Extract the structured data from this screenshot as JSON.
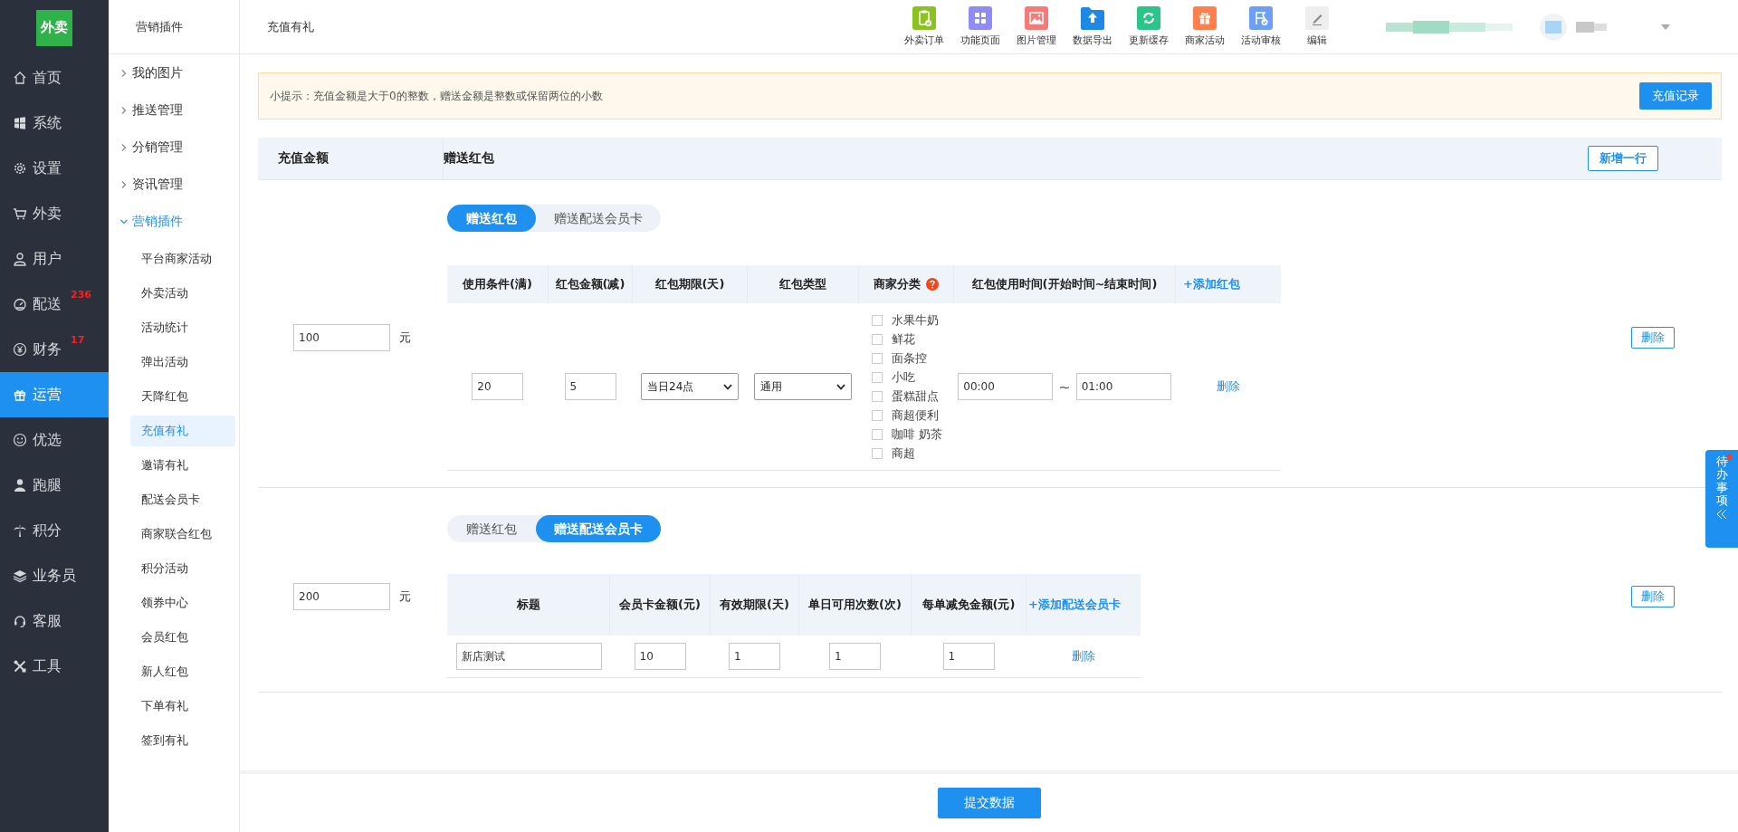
{
  "logo": {
    "text": "外卖"
  },
  "nav": [
    {
      "label": "首页",
      "selected": false
    },
    {
      "label": "系统",
      "selected": false
    },
    {
      "label": "设置",
      "selected": false
    },
    {
      "label": "外卖",
      "selected": false
    },
    {
      "label": "用户",
      "selected": false
    },
    {
      "label": "配送",
      "selected": false,
      "badge": "236"
    },
    {
      "label": "财务",
      "selected": false,
      "badge": "17"
    },
    {
      "label": "运营",
      "selected": true
    },
    {
      "label": "优选",
      "selected": false
    },
    {
      "label": "跑腿",
      "selected": false
    },
    {
      "label": "积分",
      "selected": false
    },
    {
      "label": "业务员",
      "selected": false
    },
    {
      "label": "客服",
      "selected": false
    },
    {
      "label": "工具",
      "selected": false
    }
  ],
  "submenu": {
    "title": "营销插件",
    "groups": [
      {
        "label": "我的图片",
        "expanded": false
      },
      {
        "label": "推送管理",
        "expanded": false
      },
      {
        "label": "分销管理",
        "expanded": false
      },
      {
        "label": "资讯管理",
        "expanded": false
      },
      {
        "label": "营销插件",
        "expanded": true,
        "children": [
          {
            "label": "平台商家活动",
            "selected": false
          },
          {
            "label": "外卖活动",
            "selected": false
          },
          {
            "label": "活动统计",
            "selected": false
          },
          {
            "label": "弹出活动",
            "selected": false
          },
          {
            "label": "天降红包",
            "selected": false
          },
          {
            "label": "充值有礼",
            "selected": true
          },
          {
            "label": "邀请有礼",
            "selected": false
          },
          {
            "label": "配送会员卡",
            "selected": false
          },
          {
            "label": "商家联合红包",
            "selected": false
          },
          {
            "label": "积分活动",
            "selected": false
          },
          {
            "label": "领券中心",
            "selected": false
          },
          {
            "label": "会员红包",
            "selected": false
          },
          {
            "label": "新人红包",
            "selected": false
          },
          {
            "label": "下单有礼",
            "selected": false
          },
          {
            "label": "签到有礼",
            "selected": false
          }
        ]
      }
    ]
  },
  "header": {
    "title": "充值有礼",
    "tools": [
      {
        "label": "外卖订单",
        "color": "#8cc220"
      },
      {
        "label": "功能页面",
        "color": "#8f8cf5"
      },
      {
        "label": "图片管理",
        "color": "#f77a76"
      },
      {
        "label": "数据导出",
        "color": "#1e88e5"
      },
      {
        "label": "更新缓存",
        "color": "#2bc489"
      },
      {
        "label": "商家活动",
        "color": "#ff7f4d"
      },
      {
        "label": "活动审核",
        "color": "#6d9ff5"
      },
      {
        "label": "编辑",
        "color": "#eeeeee"
      }
    ]
  },
  "notice": {
    "text": "小提示：充值金额是大于0的整数，赠送金额是整数或保留两位的小数",
    "button": "充值记录"
  },
  "table": {
    "columns": [
      "充值金额",
      "赠送红包"
    ],
    "add_button": "新增一行",
    "rows": [
      {
        "amount": "100",
        "unit": "元",
        "delete": "删除",
        "tabs": [
          {
            "label": "赠送红包",
            "selected": true
          },
          {
            "label": "赠送配送会员卡",
            "selected": false
          }
        ],
        "gift": {
          "kind": "redpacket",
          "add": "+添加红包",
          "columns": [
            {
              "label": "使用条件(满)"
            },
            {
              "label": "红包金额(减)"
            },
            {
              "label": "红包期限(天)"
            },
            {
              "label": "红包类型"
            },
            {
              "label": "商家分类",
              "help": true
            },
            {
              "label": "红包使用时间(开始时间~结束时间)"
            }
          ],
          "rows": [
            {
              "cells": [
                {
                  "kind": "input",
                  "value": "20"
                },
                {
                  "kind": "input",
                  "value": "5"
                },
                {
                  "kind": "select",
                  "value": "当日24点"
                },
                {
                  "kind": "select",
                  "value": "通用"
                },
                {
                  "kind": "checklist",
                  "items": [
                    {
                      "label": "水果牛奶",
                      "checked": false
                    },
                    {
                      "label": "鲜花",
                      "checked": false
                    },
                    {
                      "label": "面条控",
                      "checked": false
                    },
                    {
                      "label": "小吃",
                      "checked": false
                    },
                    {
                      "label": "蛋糕甜点",
                      "checked": false
                    },
                    {
                      "label": "商超便利",
                      "checked": false
                    },
                    {
                      "label": "咖啡 奶茶",
                      "checked": false
                    },
                    {
                      "label": "商超",
                      "checked": false
                    }
                  ]
                },
                {
                  "kind": "timerange",
                  "start": "00:00",
                  "sep": "~",
                  "end": "01:00"
                },
                {
                  "kind": "link",
                  "value": "删除"
                }
              ]
            }
          ]
        }
      },
      {
        "amount": "200",
        "unit": "元",
        "delete": "删除",
        "tabs": [
          {
            "label": "赠送红包",
            "selected": false
          },
          {
            "label": "赠送配送会员卡",
            "selected": true
          }
        ],
        "gift": {
          "kind": "card",
          "add": "+添加配送会员卡",
          "columns": [
            {
              "label": "标题"
            },
            {
              "label": "会员卡金额(元)"
            },
            {
              "label": "有效期限(天)"
            },
            {
              "label": "单日可用次数(次)"
            },
            {
              "label": "每单减免金额(元)"
            }
          ],
          "rows": [
            {
              "cells": [
                {
                  "kind": "input",
                  "value": "新店测试"
                },
                {
                  "kind": "input",
                  "value": "10"
                },
                {
                  "kind": "input",
                  "value": "1"
                },
                {
                  "kind": "input",
                  "value": "1"
                },
                {
                  "kind": "input",
                  "value": "1"
                },
                {
                  "kind": "link",
                  "value": "删除"
                }
              ]
            }
          ]
        }
      }
    ]
  },
  "submit": "提交数据",
  "todo": {
    "label": "待办事项",
    "dot": true
  }
}
